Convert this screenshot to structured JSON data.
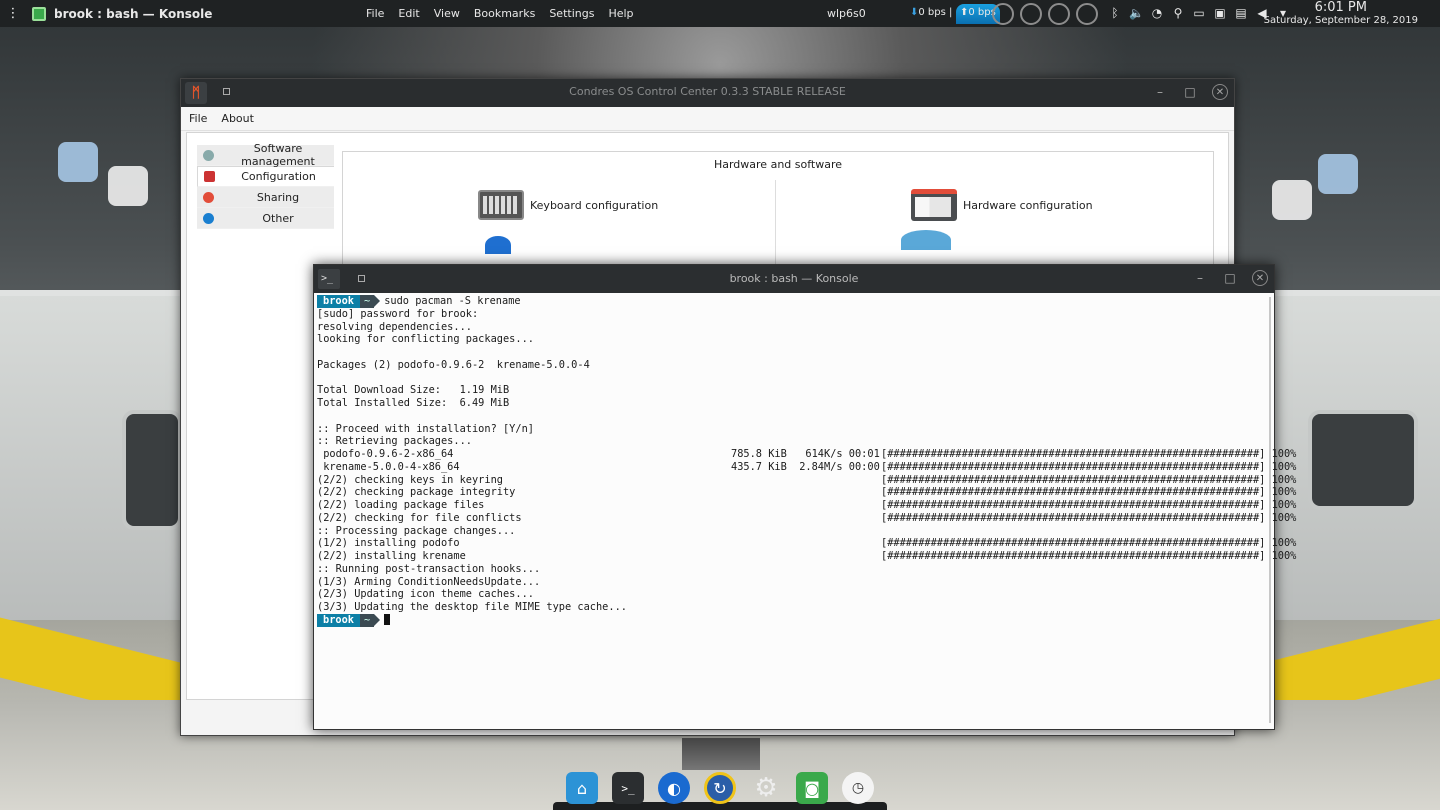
{
  "top_panel": {
    "window_title": "brook : bash — Konsole",
    "menu": [
      "File",
      "Edit",
      "View",
      "Bookmarks",
      "Settings",
      "Help"
    ],
    "network_interface": "wlp6s0",
    "download_rate": "0 bps |",
    "upload_rate": "0 bps",
    "clock_time": "6:01 PM",
    "clock_date": "Saturday, September 28, 2019"
  },
  "control_center": {
    "title": "Condres OS Control Center 0.3.3 STABLE RELEASE",
    "menu": [
      "File",
      "About"
    ],
    "sidebar": [
      {
        "label": "Software management",
        "icon": "package-icon",
        "color": "#8aa"
      },
      {
        "label": "Configuration",
        "icon": "config-icon",
        "color": "#c33"
      },
      {
        "label": "Sharing",
        "icon": "share-icon",
        "color": "#e24d3a"
      },
      {
        "label": "Other",
        "icon": "info-icon",
        "color": "#1a7fd0"
      }
    ],
    "group_title": "Hardware and software",
    "tiles": [
      {
        "label": "Keyboard configuration",
        "icon": "keyboard-icon"
      },
      {
        "label": "Hardware configuration",
        "icon": "hardware-icon"
      }
    ]
  },
  "konsole": {
    "title": "brook : bash — Konsole",
    "prompt_user": "brook",
    "prompt_dir": "~",
    "command": "sudo pacman -S krename",
    "lines": [
      "[sudo] password for brook:",
      "resolving dependencies...",
      "looking for conflicting packages...",
      "",
      "Packages (2) podofo-0.9.6-2  krename-5.0.0-4",
      "",
      "Total Download Size:   1.19 MiB",
      "Total Installed Size:  6.49 MiB",
      "",
      ":: Proceed with installation? [Y/n]",
      ":: Retrieving packages..."
    ],
    "progress_lines": [
      {
        "text": " podofo-0.9.6-2-x86_64",
        "meta": "785.8 KiB   614K/s 00:01",
        "percent": "100%"
      },
      {
        "text": " krename-5.0.0-4-x86_64",
        "meta": "435.7 KiB  2.84M/s 00:00",
        "percent": "100%"
      },
      {
        "text": "(2/2) checking keys in keyring",
        "meta": "",
        "percent": "100%"
      },
      {
        "text": "(2/2) checking package integrity",
        "meta": "",
        "percent": "100%"
      },
      {
        "text": "(2/2) loading package files",
        "meta": "",
        "percent": "100%"
      },
      {
        "text": "(2/2) checking for file conflicts",
        "meta": "",
        "percent": "100%"
      },
      {
        "text": ":: Processing package changes...",
        "meta": null,
        "percent": null
      },
      {
        "text": "(1/2) installing podofo",
        "meta": "",
        "percent": "100%"
      },
      {
        "text": "(2/2) installing krename",
        "meta": "",
        "percent": "100%"
      }
    ],
    "post_lines": [
      ":: Running post-transaction hooks...",
      "(1/3) Arming ConditionNeedsUpdate...",
      "(2/3) Updating icon theme caches...",
      "(3/3) Updating the desktop file MIME type cache..."
    ]
  },
  "dock": [
    "home-icon",
    "terminal-icon",
    "browser-icon",
    "updater-icon",
    "settings-icon",
    "screenshot-icon",
    "clock-icon"
  ]
}
